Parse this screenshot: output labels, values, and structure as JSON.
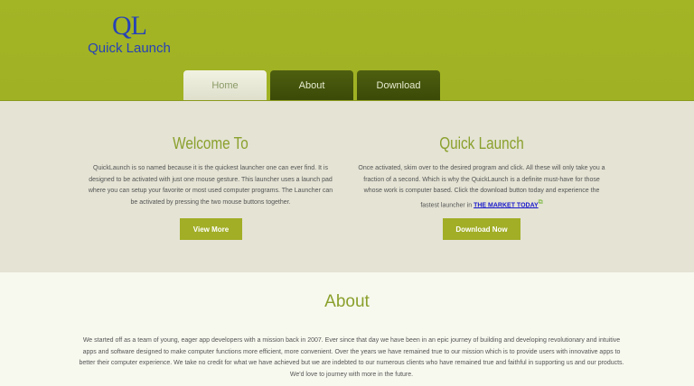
{
  "logo": {
    "mark": "QL",
    "name": "Quick Launch"
  },
  "nav": {
    "tabs": [
      {
        "label": "Home"
      },
      {
        "label": "About"
      },
      {
        "label": "Download"
      }
    ]
  },
  "features": {
    "left": {
      "title": "Welcome To",
      "text": "QuickLaunch is so named because it is the quickest launcher one can ever find. It is designed to be activated with just one mouse gesture. This launcher uses a launch pad where you can setup your favorite or most used computer programs. The Launcher can be activated by pressing the two mouse buttons together.",
      "button": "View More"
    },
    "right": {
      "title": "Quick Launch",
      "text": "Once activated, skim over to the desired program and click. All these will only take you a fraction of a second. Which is why the QuickLaunch is a definite must-have for those whose work is computer based. Click the download button today and experience the fastest launcher in ",
      "link": "THE MARKET TODAY",
      "link_icon": "external-link-icon",
      "button": "Download Now"
    }
  },
  "about": {
    "title": "About",
    "text": "We started off as a team of young, eager app developers with a mission back in 2007. Ever since that day we have been in an epic journey of building and developing revolutionary and intuitive apps and software designed to make computer functions more efficient, more convenient. Over the years we have remained true to our mission which is to provide users with innovative apps to better their computer experience. We take no credit for what we have achieved but we are indebted to our numerous clients who have remained true and faithful in supporting us and our products. We'd love to journey with more in the future."
  },
  "colors": {
    "header": "#a3b425",
    "tab_dark": "#3f4e09",
    "accent_text": "#8aa02c",
    "button": "#a1ae26",
    "logo": "#2742b6"
  }
}
